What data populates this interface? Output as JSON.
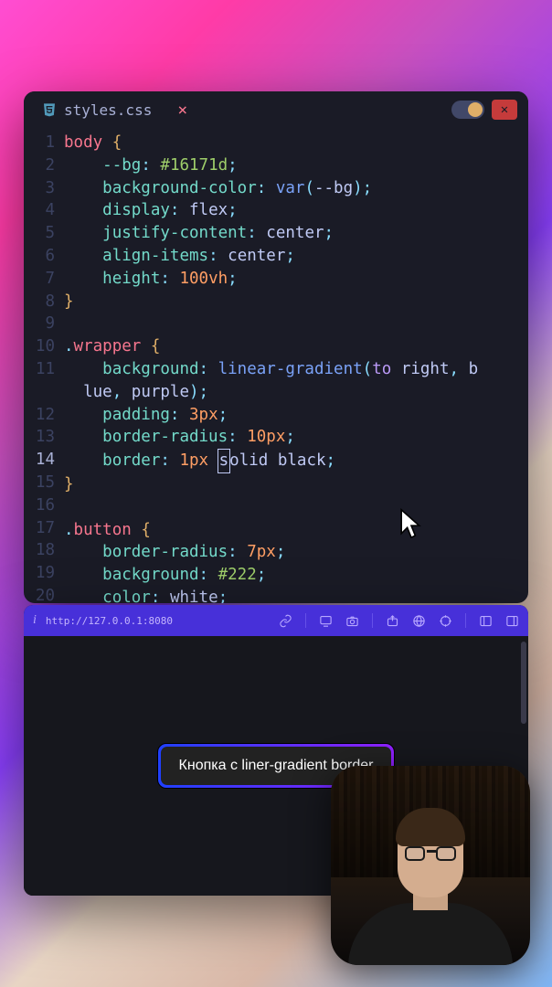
{
  "editor": {
    "filename": "styles.css",
    "active_line": 14,
    "lines": [
      {
        "n": 1,
        "html": "<span class='sel'>body</span> <span class='brace'>{</span>"
      },
      {
        "n": 2,
        "html": "    <span class='prop'>--bg</span><span class='punc'>:</span> <span class='strc'>#16171d</span><span class='punc'>;</span>"
      },
      {
        "n": 3,
        "html": "    <span class='prop'>background-color</span><span class='punc'>:</span> <span class='func'>var</span><span class='punc'>(</span><span class='val'>--bg</span><span class='punc'>);</span>"
      },
      {
        "n": 4,
        "html": "    <span class='prop'>display</span><span class='punc'>:</span> <span class='val'>flex</span><span class='punc'>;</span>"
      },
      {
        "n": 5,
        "html": "    <span class='prop'>justify-content</span><span class='punc'>:</span> <span class='val'>center</span><span class='punc'>;</span>"
      },
      {
        "n": 6,
        "html": "    <span class='prop'>align-items</span><span class='punc'>:</span> <span class='val'>center</span><span class='punc'>;</span>"
      },
      {
        "n": 7,
        "html": "    <span class='prop'>height</span><span class='punc'>:</span> <span class='num'>100vh</span><span class='punc'>;</span>"
      },
      {
        "n": 8,
        "html": "<span class='brace'>}</span>"
      },
      {
        "n": 9,
        "html": ""
      },
      {
        "n": 10,
        "html": "<span class='punc'>.</span><span class='sel'>wrapper</span> <span class='brace'>{</span>"
      },
      {
        "n": 11,
        "html": "    <span class='prop'>background</span><span class='punc'>:</span> <span class='func'>linear-gradient</span><span class='punc'>(</span><span class='kw'>to</span> <span class='val'>right</span><span class='punc'>,</span> <span class='val'>b</span>\n  <span class='val'>lue</span><span class='punc'>,</span> <span class='val'>purple</span><span class='punc'>);</span>"
      },
      {
        "n": 12,
        "html": "    <span class='prop'>padding</span><span class='punc'>:</span> <span class='num'>3px</span><span class='punc'>;</span>"
      },
      {
        "n": 13,
        "html": "    <span class='prop'>border-radius</span><span class='punc'>:</span> <span class='num'>10px</span><span class='punc'>;</span>"
      },
      {
        "n": 14,
        "html": "    <span class='prop'>border</span><span class='punc'>:</span> <span class='num'>1px</span> <span class='cursor-box'>s</span><span class='val'>olid black</span><span class='punc'>;</span>"
      },
      {
        "n": 15,
        "html": "<span class='brace'>}</span>"
      },
      {
        "n": 16,
        "html": ""
      },
      {
        "n": 17,
        "html": "<span class='punc'>.</span><span class='sel'>button</span> <span class='brace'>{</span>"
      },
      {
        "n": 18,
        "html": "    <span class='prop'>border-radius</span><span class='punc'>:</span> <span class='num'>7px</span><span class='punc'>;</span>"
      },
      {
        "n": 19,
        "html": "    <span class='prop'>background</span><span class='punc'>:</span> <span class='strc'>#222</span><span class='punc'>;</span>"
      },
      {
        "n": 20,
        "html": "    <span class='prop'>color</span><span class='punc'>:</span> <span class='val'>white</span><span class='punc'>;</span>"
      }
    ]
  },
  "browser": {
    "url": "http://127.0.0.1:8080",
    "button_text": "Кнопка с liner-gradient border"
  }
}
